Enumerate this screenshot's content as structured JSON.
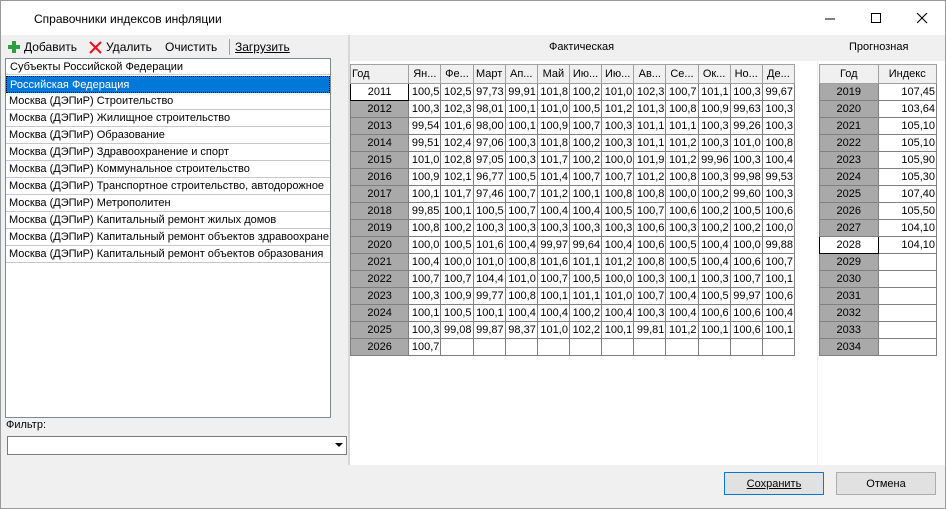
{
  "window": {
    "title": "Справочники индексов инфляции"
  },
  "toolbar": {
    "add_label": "Добавить",
    "delete_label": "Удалить",
    "clear_label": "Очистить",
    "load_label": "Загрузить"
  },
  "subjects": {
    "header": "Субъекты Российской Федерации",
    "items": [
      "Российская Федерация",
      "Москва (ДЭПиР) Строительство",
      "Москва (ДЭПиР) Жилищное строительство",
      "Москва (ДЭПиР) Образование",
      "Москва (ДЭПиР) Здравоохранение и спорт",
      "Москва (ДЭПиР) Коммунальное строительство",
      "Москва (ДЭПиР) Транспортное строительство, автодорожное",
      "Москва (ДЭПиР) Метрополитен",
      "Москва (ДЭПиР) Капитальный ремонт жилых домов",
      "Москва (ДЭПиР) Капитальный ремонт объектов здравоохране",
      "Москва (ДЭПиР) Капитальный ремонт объектов образования"
    ],
    "selected_index": 0
  },
  "filter": {
    "label": "Фильтр:",
    "value": ""
  },
  "actual": {
    "title": "Фактическая",
    "columns": [
      "Год",
      "Ян...",
      "Фе...",
      "Март",
      "Ап...",
      "Май",
      "Ию...",
      "Ию...",
      "Ав...",
      "Се...",
      "Ок...",
      "Но...",
      "Де..."
    ],
    "rows": [
      [
        "2011",
        "100,5",
        "102,5",
        "97,73",
        "99,91",
        "101,8",
        "100,2",
        "101,0",
        "102,3",
        "100,7",
        "101,1",
        "100,3",
        "99,67"
      ],
      [
        "2012",
        "100,3",
        "102,3",
        "98,01",
        "100,1",
        "101,0",
        "100,5",
        "101,2",
        "101,3",
        "100,8",
        "100,9",
        "99,63",
        "100,3"
      ],
      [
        "2013",
        "99,54",
        "101,6",
        "98,00",
        "100,1",
        "100,9",
        "100,7",
        "100,3",
        "101,1",
        "101,1",
        "100,3",
        "99,26",
        "100,3"
      ],
      [
        "2014",
        "99,51",
        "102,4",
        "97,06",
        "100,3",
        "101,8",
        "100,2",
        "100,3",
        "101,1",
        "101,2",
        "100,3",
        "101,0",
        "100,8"
      ],
      [
        "2015",
        "101,0",
        "102,8",
        "97,05",
        "100,3",
        "101,7",
        "100,2",
        "100,0",
        "101,9",
        "101,2",
        "99,96",
        "100,3",
        "100,4"
      ],
      [
        "2016",
        "100,9",
        "102,1",
        "96,77",
        "100,5",
        "101,4",
        "100,7",
        "100,7",
        "101,2",
        "100,8",
        "100,3",
        "99,98",
        "99,53"
      ],
      [
        "2017",
        "100,1",
        "101,7",
        "97,46",
        "100,7",
        "101,2",
        "100,1",
        "100,8",
        "100,8",
        "100,0",
        "100,2",
        "99,60",
        "100,3"
      ],
      [
        "2018",
        "99,85",
        "100,1",
        "100,5",
        "100,7",
        "100,4",
        "100,4",
        "100,5",
        "100,7",
        "100,6",
        "100,2",
        "100,5",
        "100,6"
      ],
      [
        "2019",
        "100,8",
        "100,2",
        "100,3",
        "100,3",
        "100,3",
        "100,3",
        "100,3",
        "100,6",
        "100,3",
        "100,2",
        "100,2",
        "100,0"
      ],
      [
        "2020",
        "100,0",
        "100,5",
        "101,6",
        "100,4",
        "99,97",
        "99,64",
        "100,4",
        "100,6",
        "100,5",
        "100,4",
        "100,0",
        "99,88"
      ],
      [
        "2021",
        "100,4",
        "100,0",
        "101,0",
        "100,8",
        "101,6",
        "101,1",
        "101,2",
        "100,8",
        "100,5",
        "100,4",
        "100,6",
        "100,7"
      ],
      [
        "2022",
        "100,7",
        "100,7",
        "104,4",
        "101,0",
        "100,7",
        "100,5",
        "100,0",
        "100,3",
        "100,1",
        "100,3",
        "100,7",
        "100,1"
      ],
      [
        "2023",
        "100,3",
        "100,9",
        "99,77",
        "100,8",
        "100,1",
        "101,1",
        "101,0",
        "100,7",
        "100,4",
        "100,5",
        "99,97",
        "100,6"
      ],
      [
        "2024",
        "100,1",
        "100,5",
        "100,1",
        "100,4",
        "100,4",
        "100,2",
        "100,4",
        "100,3",
        "100,4",
        "100,6",
        "100,6",
        "100,4"
      ],
      [
        "2025",
        "100,3",
        "99,08",
        "99,87",
        "98,37",
        "101,0",
        "102,2",
        "100,1",
        "99,81",
        "101,2",
        "100,1",
        "100,6",
        "100,1"
      ],
      [
        "2026",
        "100,7",
        "",
        "",
        "",
        "",
        "",
        "",
        "",
        "",
        "",
        "",
        ""
      ]
    ],
    "current_row": 0
  },
  "forecast": {
    "title": "Прогнозная",
    "columns": [
      "Год",
      "Индекс"
    ],
    "rows": [
      [
        "2019",
        "107,45"
      ],
      [
        "2020",
        "103,64"
      ],
      [
        "2021",
        "105,10"
      ],
      [
        "2022",
        "105,10"
      ],
      [
        "2023",
        "105,90"
      ],
      [
        "2024",
        "105,30"
      ],
      [
        "2025",
        "107,40"
      ],
      [
        "2026",
        "105,50"
      ],
      [
        "2027",
        "104,10"
      ],
      [
        "2028",
        "104,10"
      ],
      [
        "2029",
        ""
      ],
      [
        "2030",
        ""
      ],
      [
        "2031",
        ""
      ],
      [
        "2032",
        ""
      ],
      [
        "2033",
        ""
      ],
      [
        "2034",
        ""
      ]
    ],
    "current_row": 9
  },
  "buttons": {
    "save_label": "Сохранить",
    "cancel_label": "Отмена"
  },
  "colors": {
    "selection": "#0078d7",
    "year_cell": "#a9a9a9",
    "add_icon": "#2ea043",
    "delete_icon": "#e81123"
  }
}
